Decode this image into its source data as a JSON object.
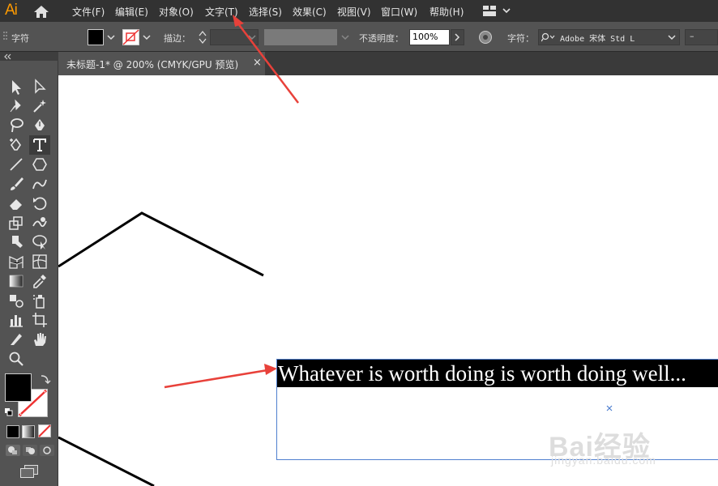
{
  "app": {
    "logo": "Ai"
  },
  "menu": [
    {
      "label": "文件(F)"
    },
    {
      "label": "编辑(E)"
    },
    {
      "label": "对象(O)"
    },
    {
      "label": "文字(T)"
    },
    {
      "label": "选择(S)"
    },
    {
      "label": "效果(C)"
    },
    {
      "label": "视图(V)"
    },
    {
      "label": "窗口(W)"
    },
    {
      "label": "帮助(H)"
    }
  ],
  "control_bar": {
    "panel_label": "字符",
    "stroke_label": "描边：",
    "opacity_label": "不透明度：",
    "opacity_value": "100%",
    "character_label": "字符：",
    "font_value": "Adobe 宋体 Std L",
    "size_value": "–"
  },
  "tab": {
    "title": "未标题-1* @ 200% (CMYK/GPU 预览)",
    "close": "×"
  },
  "canvas": {
    "text": "Whatever is worth doing is worth doing well..."
  },
  "watermark": {
    "brand": "Bai经验",
    "url": "jingyan.baidu.com"
  },
  "colors": {
    "arrow": "#e8413a",
    "selection_frame": "#4f7fcf",
    "logo": "#ff9a00"
  }
}
